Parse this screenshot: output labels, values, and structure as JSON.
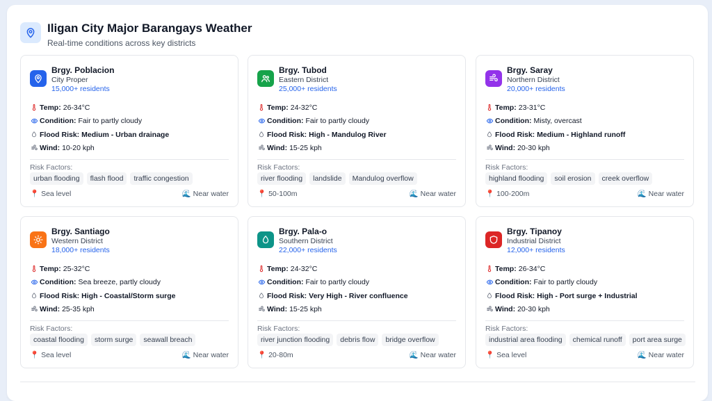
{
  "header": {
    "title": "Iligan City Major Barangays Weather",
    "subtitle": "Real-time conditions across key districts",
    "icon": "map-pin-icon"
  },
  "labels": {
    "temp": "Temp:",
    "condition": "Condition:",
    "flood": "Flood Risk:",
    "wind": "Wind:",
    "risk_factors": "Risk Factors:",
    "near_water": "Near water"
  },
  "cards": [
    {
      "name": "Brgy. Poblacion",
      "district": "City Proper",
      "residents": "15,000+ residents",
      "icon": "map-pin-icon",
      "color": "#2563eb",
      "temp": "26-34°C",
      "condition": "Fair to partly cloudy",
      "flood": "Medium - Urban drainage",
      "wind": "10-20 kph",
      "tags": [
        "urban flooding",
        "flash flood",
        "traffic congestion"
      ],
      "elevation": "Sea level"
    },
    {
      "name": "Brgy. Tubod",
      "district": "Eastern District",
      "residents": "25,000+ residents",
      "icon": "users-icon",
      "color": "#16a34a",
      "temp": "24-32°C",
      "condition": "Fair to partly cloudy",
      "flood": "High - Mandulog River",
      "wind": "15-25 kph",
      "tags": [
        "river flooding",
        "landslide",
        "Mandulog overflow"
      ],
      "elevation": "50-100m"
    },
    {
      "name": "Brgy. Saray",
      "district": "Northern District",
      "residents": "20,000+ residents",
      "icon": "wind-icon",
      "color": "#9333ea",
      "temp": "23-31°C",
      "condition": "Misty, overcast",
      "flood": "Medium - Highland runoff",
      "wind": "20-30 kph",
      "tags": [
        "highland flooding",
        "soil erosion",
        "creek overflow"
      ],
      "elevation": "100-200m"
    },
    {
      "name": "Brgy. Santiago",
      "district": "Western District",
      "residents": "18,000+ residents",
      "icon": "sun-icon",
      "color": "#f97316",
      "temp": "25-32°C",
      "condition": "Sea breeze, partly cloudy",
      "flood": "High - Coastal/Storm surge",
      "wind": "25-35 kph",
      "tags": [
        "coastal flooding",
        "storm surge",
        "seawall breach"
      ],
      "elevation": "Sea level"
    },
    {
      "name": "Brgy. Pala-o",
      "district": "Southern District",
      "residents": "22,000+ residents",
      "icon": "droplet-icon",
      "color": "#0d9488",
      "temp": "24-32°C",
      "condition": "Fair to partly cloudy",
      "flood": "Very High - River confluence",
      "wind": "15-25 kph",
      "tags": [
        "river junction flooding",
        "debris flow",
        "bridge overflow"
      ],
      "elevation": "20-80m"
    },
    {
      "name": "Brgy. Tipanoy",
      "district": "Industrial District",
      "residents": "12,000+ residents",
      "icon": "shield-icon",
      "color": "#dc2626",
      "temp": "26-34°C",
      "condition": "Fair to partly cloudy",
      "flood": "High - Port surge + Industrial",
      "wind": "20-30 kph",
      "tags": [
        "industrial area flooding",
        "chemical runoff",
        "port area surge"
      ],
      "elevation": "Sea level"
    }
  ]
}
